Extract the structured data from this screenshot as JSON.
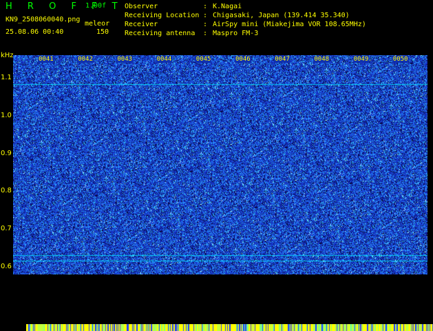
{
  "header": {
    "brand": "H R O F F T",
    "version": "1.00f",
    "filename": "KN9_2508060040.png",
    "mode": "meleor",
    "datetime": "25.08.06 00:40",
    "count": "150"
  },
  "meta": [
    {
      "label": "Observer",
      "value": "K.Nagai"
    },
    {
      "label": "Receiving Location",
      "value": "Chigasaki, Japan (139.414 35.340)"
    },
    {
      "label": "Receiver",
      "value": "AirSpy mini (Miakejima VOR 108.65MHz)"
    },
    {
      "label": "Receiving antenna",
      "value": "Maspro FM-3"
    }
  ],
  "meta_sep": ":",
  "axis": {
    "unit": "kHz",
    "y_ticks": [
      {
        "label": "1.1",
        "value": 1.1
      },
      {
        "label": "1.0",
        "value": 1.0
      },
      {
        "label": "0.9",
        "value": 0.9
      },
      {
        "label": "0.8",
        "value": 0.8
      },
      {
        "label": "0.7",
        "value": 0.7
      },
      {
        "label": "0.6",
        "value": 0.6
      }
    ],
    "y_range": [
      0.58,
      1.16
    ],
    "time_labels": [
      "0041",
      "0042",
      "0043",
      "0044",
      "0045",
      "0046",
      "0047",
      "0048",
      "0049",
      "0050"
    ]
  },
  "colors": {
    "text": "#ffff00",
    "brand": "#00ff00",
    "plot_bg": "#1a33c8",
    "trace": "#00e8ff"
  }
}
